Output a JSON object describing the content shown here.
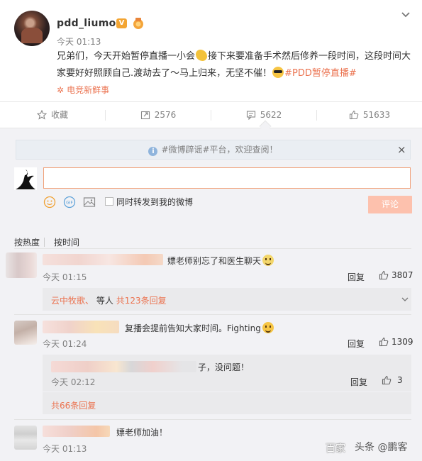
{
  "post": {
    "username": "pdd_liumou",
    "verified_badge": "V",
    "time": "今天 01:13",
    "text_part1": "兄弟们，今天开始暂停直播一小会",
    "text_part2": "接下来要准备手术然后修养一段时间，这段时间大家要好好照顾自己.渡劫去了～马上归来，无坚不催！",
    "hashtag": "#PDD暂停直播#",
    "topic": "电竞新鲜事",
    "emoji_arm": "flexed-arm-emoji",
    "emoji_cool": "sunglasses-emoji"
  },
  "actions": {
    "collect": "收藏",
    "forward": "2576",
    "comment": "5622",
    "like": "51633"
  },
  "comment_box": {
    "notice": "#微博辟谣#平台，欢迎查阅！",
    "close": "×",
    "forward_label": "同时转发到我的微博",
    "submit": "评论"
  },
  "sort": {
    "by_hot": "按热度",
    "by_time": "按时间"
  },
  "comments": [
    {
      "text": "嫖老师别忘了和医生聊天",
      "time": "今天 01:15",
      "reply": "回复",
      "likes": "3807",
      "sub_user": "云中牧歌、",
      "sub_mid": "等人",
      "sub_count": "共123条回复"
    },
    {
      "text": "复播会提前告知大家时间。Fighting",
      "time": "今天 01:24",
      "reply": "回复",
      "likes": "1309",
      "sub_text": "子，没问题！",
      "sub_time": "今天 02:12",
      "sub_reply": "回复",
      "sub_likes": "3",
      "more": "共66条回复"
    },
    {
      "text": "嫖老师加油！",
      "time": "今天 01:13"
    }
  ],
  "watermark": {
    "left": "百家",
    "right": "头条 @鹏客"
  },
  "colors": {
    "accent": "#eb7350",
    "bg_comments": "#f2f2f5",
    "input_border": "#f0a078",
    "submit_bg": "#fdc1ad",
    "badge": "#f3a533"
  }
}
